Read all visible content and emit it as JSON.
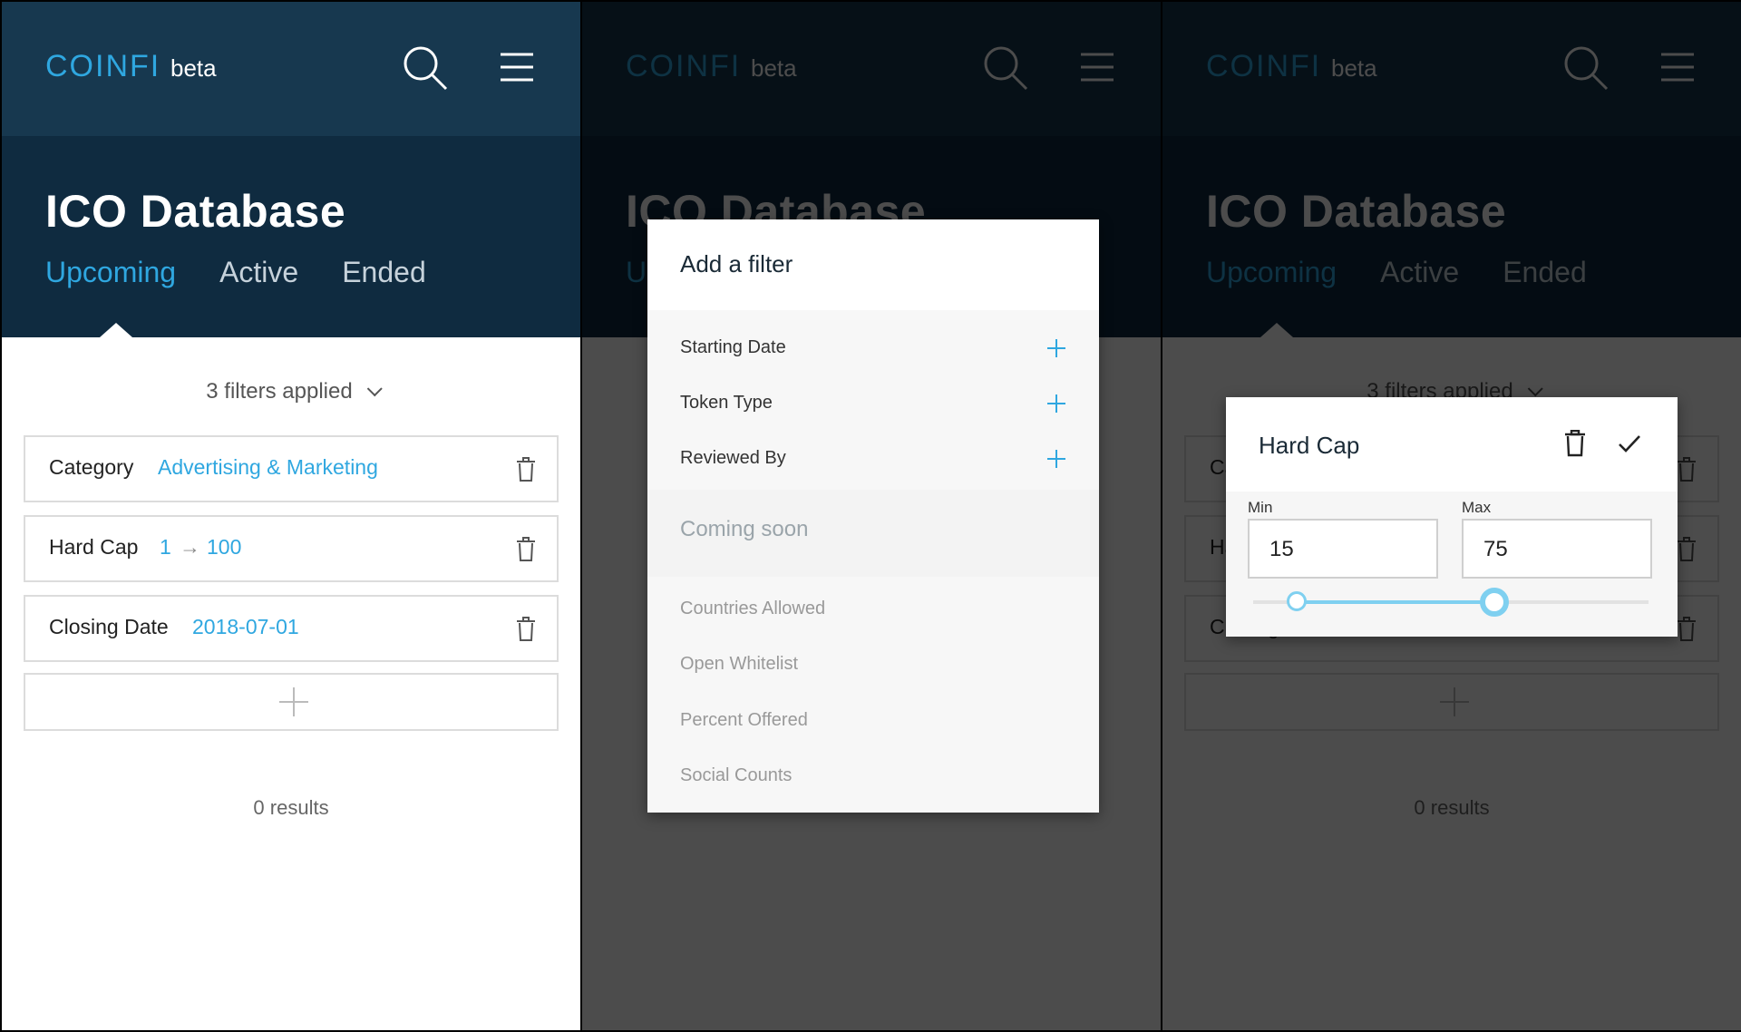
{
  "brand": {
    "logo": "COINFI",
    "beta": "beta"
  },
  "page": {
    "title": "ICO Database"
  },
  "tabs": [
    "Upcoming",
    "Active",
    "Ended"
  ],
  "filters_summary": "3 filters applied",
  "filters": [
    {
      "label": "Category",
      "value": "Advertising & Marketing"
    },
    {
      "label": "Hard Cap",
      "from": "1",
      "arrow": "→",
      "to": "100"
    },
    {
      "label": "Closing Date",
      "value": "2018-07-01"
    }
  ],
  "results": "0 results",
  "add_filter_modal": {
    "title": "Add a filter",
    "available": [
      "Starting Date",
      "Token Type",
      "Reviewed By"
    ],
    "coming_soon_label": "Coming soon",
    "coming_soon": [
      "Countries Allowed",
      "Open Whitelist",
      "Percent Offered",
      "Social Counts"
    ]
  },
  "hard_cap_modal": {
    "title": "Hard Cap",
    "min_label": "Min",
    "max_label": "Max",
    "min_value": "15",
    "max_value": "75",
    "slider_min_fraction": 0.11,
    "slider_max_fraction": 0.61
  },
  "colors": {
    "accent": "#2fa7e0",
    "header_bg": "#17384f",
    "hero_bg": "#0f2b40"
  }
}
